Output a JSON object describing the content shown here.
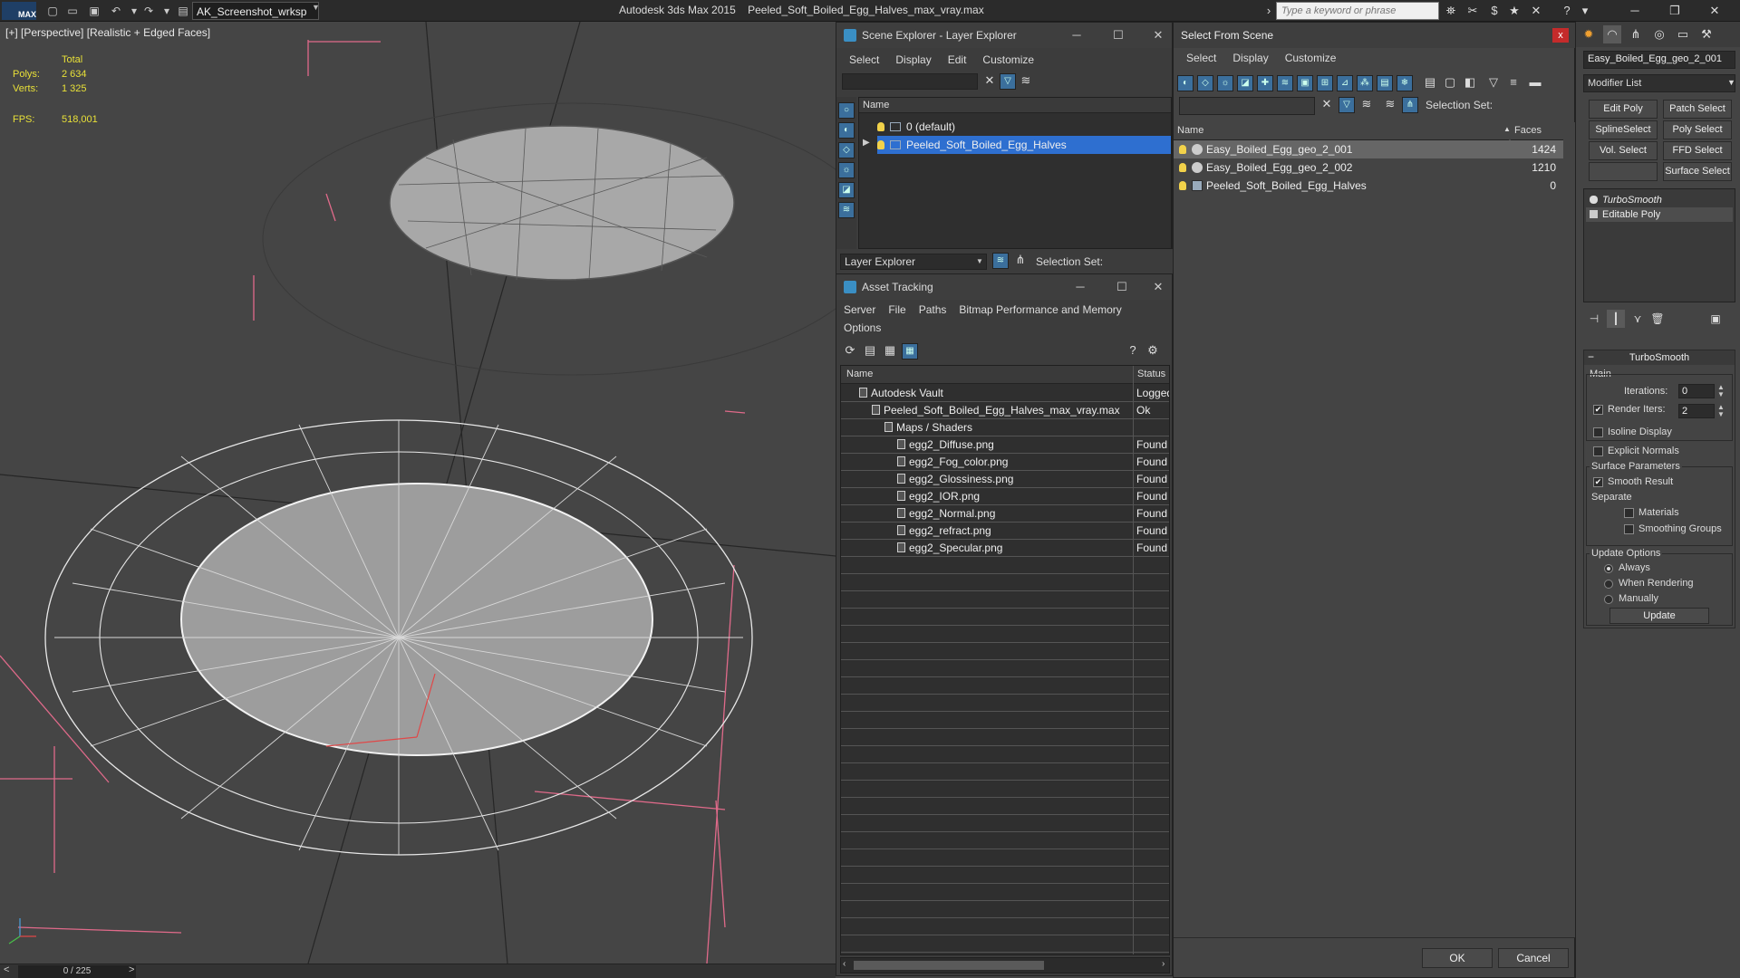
{
  "titlebar": {
    "logo": "MAX",
    "workspace": "AK_Screenshot_wrksp",
    "app_name": "Autodesk 3ds Max  2015",
    "file_name": "Peeled_Soft_Boiled_Egg_Halves_max_vray.max",
    "search_placeholder": "Type a keyword or phrase"
  },
  "viewport": {
    "label": "[+] [Perspective] [Realistic + Edged Faces]",
    "stats": {
      "total_label": "Total",
      "polys_label": "Polys:",
      "polys_value": "2 634",
      "verts_label": "Verts:",
      "verts_value": "1 325",
      "fps_label": "FPS:",
      "fps_value": "518,001"
    }
  },
  "timeslider": {
    "left": "<",
    "value": "0 / 225",
    "right": ">"
  },
  "scene_explorer": {
    "title": "Scene Explorer - Layer Explorer",
    "menu": [
      "Select",
      "Display",
      "Edit",
      "Customize"
    ],
    "column": "Name",
    "rows": [
      {
        "label": "0 (default)",
        "selected": false
      },
      {
        "label": "Peeled_Soft_Boiled_Egg_Halves",
        "selected": true
      }
    ],
    "explorer_dropdown": "Layer Explorer",
    "selection_set_label": "Selection Set:"
  },
  "asset_tracking": {
    "title": "Asset Tracking",
    "menu1": [
      "Server",
      "File",
      "Paths",
      "Bitmap Performance and Memory"
    ],
    "menu2": [
      "Options"
    ],
    "col_name": "Name",
    "col_status": "Status",
    "rows": [
      {
        "name": "Autodesk Vault",
        "status": "Logged",
        "indent": 0
      },
      {
        "name": "Peeled_Soft_Boiled_Egg_Halves_max_vray.max",
        "status": "Ok",
        "indent": 1
      },
      {
        "name": "Maps / Shaders",
        "status": "",
        "indent": 2
      },
      {
        "name": "egg2_Diffuse.png",
        "status": "Found",
        "indent": 3
      },
      {
        "name": "egg2_Fog_color.png",
        "status": "Found",
        "indent": 3
      },
      {
        "name": "egg2_Glossiness.png",
        "status": "Found",
        "indent": 3
      },
      {
        "name": "egg2_IOR.png",
        "status": "Found",
        "indent": 3
      },
      {
        "name": "egg2_Normal.png",
        "status": "Found",
        "indent": 3
      },
      {
        "name": "egg2_refract.png",
        "status": "Found",
        "indent": 3
      },
      {
        "name": "egg2_Specular.png",
        "status": "Found",
        "indent": 3
      }
    ]
  },
  "select_from_scene": {
    "title": "Select From Scene",
    "close": "x",
    "menu": [
      "Select",
      "Display",
      "Customize"
    ],
    "selection_set_label": "Selection Set:",
    "col_name": "Name",
    "col_faces": "Faces",
    "rows": [
      {
        "name": "Easy_Boiled_Egg_geo_2_001",
        "faces": "1424",
        "selected": true
      },
      {
        "name": "Easy_Boiled_Egg_geo_2_002",
        "faces": "1210",
        "selected": false
      },
      {
        "name": "Peeled_Soft_Boiled_Egg_Halves",
        "faces": "0",
        "selected": false
      }
    ],
    "ok_label": "OK",
    "cancel_label": "Cancel"
  },
  "command_panel": {
    "object_name": "Easy_Boiled_Egg_geo_2_001",
    "modifier_list": "Modifier List",
    "buttons": [
      "Edit Poly",
      "Patch Select",
      "SplineSelect",
      "Poly Select",
      "Vol. Select",
      "FFD Select",
      "",
      "Surface Select"
    ],
    "stack": [
      "TurboSmooth",
      "Editable Poly"
    ],
    "turbosmooth": {
      "title": "TurboSmooth",
      "main_label": "Main",
      "iterations_label": "Iterations:",
      "iterations_value": "0",
      "render_iters_label": "Render Iters:",
      "render_iters_value": "2",
      "render_iters_checked": true,
      "isoline_label": "Isoline Display",
      "isoline_checked": false,
      "explicit_normals_label": "Explicit Normals",
      "explicit_normals_checked": false,
      "surface_params_label": "Surface Parameters",
      "smooth_result_label": "Smooth Result",
      "smooth_result_checked": true,
      "separate_label": "Separate",
      "materials_label": "Materials",
      "materials_checked": false,
      "smoothing_groups_label": "Smoothing Groups",
      "smoothing_groups_checked": false,
      "update_options_label": "Update Options",
      "always_label": "Always",
      "when_rendering_label": "When Rendering",
      "manually_label": "Manually",
      "update_selected": "Always",
      "update_button": "Update"
    }
  },
  "colors": {
    "accent_blue": "#2e6fd0",
    "stats_yellow": "#e8e038",
    "close_red": "#c42b2b",
    "bbox_pink": "#e06a8a"
  }
}
